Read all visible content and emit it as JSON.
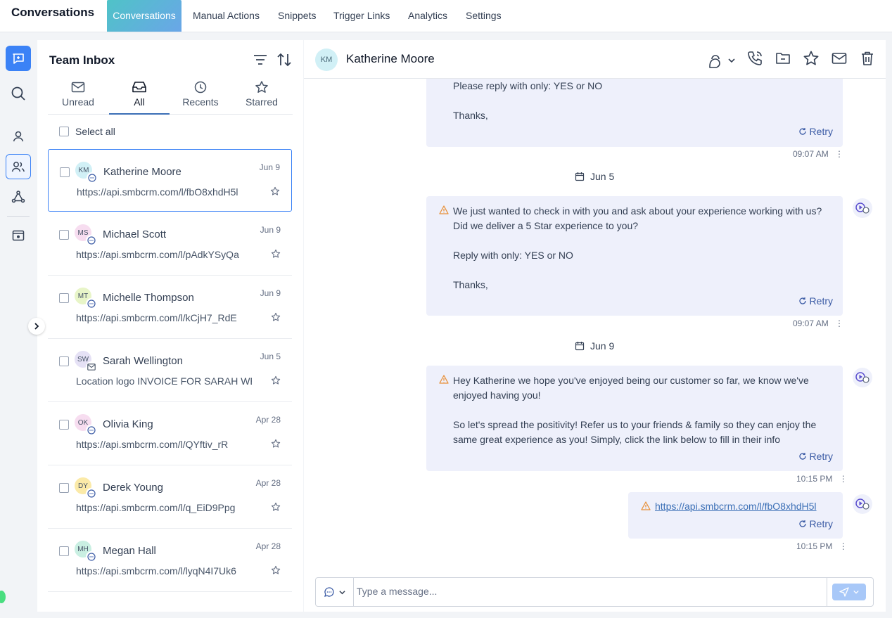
{
  "app": {
    "title": "Conversations"
  },
  "nav": {
    "tabs": [
      {
        "label": "Conversations",
        "active": true
      },
      {
        "label": "Manual Actions"
      },
      {
        "label": "Snippets"
      },
      {
        "label": "Trigger Links"
      },
      {
        "label": "Analytics"
      },
      {
        "label": "Settings"
      }
    ]
  },
  "rail": {
    "items": [
      "conversations-icon",
      "search-icon",
      "contact-icon",
      "team-icon",
      "workflow-icon",
      "preview-icon"
    ]
  },
  "inbox": {
    "title": "Team Inbox",
    "tabs": [
      {
        "label": "Unread",
        "icon": "inbox-icon"
      },
      {
        "label": "All",
        "icon": "tray-icon",
        "active": true
      },
      {
        "label": "Recents",
        "icon": "clock-icon"
      },
      {
        "label": "Starred",
        "icon": "star-icon"
      }
    ],
    "select_all": "Select all",
    "conversations": [
      {
        "initials": "KM",
        "name": "Katherine Moore",
        "date": "Jun 9",
        "preview": "https://api.smbcrm.com/l/fbO8xhdH5l",
        "channel": "chat",
        "color": "#d1f0f6"
      },
      {
        "initials": "MS",
        "name": "Michael Scott",
        "date": "Jun 9",
        "preview": "https://api.smbcrm.com/l/pAdkYSyQa",
        "channel": "chat",
        "color": "#f7ddf0"
      },
      {
        "initials": "MT",
        "name": "Michelle Thompson",
        "date": "Jun 9",
        "preview": "https://api.smbcrm.com/l/kCjH7_RdE",
        "channel": "chat",
        "color": "#e8f5c8"
      },
      {
        "initials": "SW",
        "name": "Sarah Wellington",
        "date": "Jun 5",
        "preview": "Location logo INVOICE FOR SARAH WELLINGTON",
        "channel": "email",
        "color": "#e5e1f5"
      },
      {
        "initials": "OK",
        "name": "Olivia King",
        "date": "Apr 28",
        "preview": "https://api.smbcrm.com/l/QYftiv_rR",
        "channel": "chat",
        "color": "#f7ddf0"
      },
      {
        "initials": "DY",
        "name": "Derek Young",
        "date": "Apr 28",
        "preview": "https://api.smbcrm.com/l/q_EiD9Ppg",
        "channel": "chat",
        "color": "#fbeaa8"
      },
      {
        "initials": "MH",
        "name": "Megan Hall",
        "date": "Apr 28",
        "preview": "https://api.smbcrm.com/l/lyqN4I7Uk6",
        "channel": "chat",
        "color": "#c9efe2"
      }
    ]
  },
  "chat": {
    "contact_initials": "KM",
    "contact_name": "Katherine Moore",
    "actions": [
      "support-agent-icon",
      "phone-icon",
      "folder-icon",
      "star-icon",
      "mail-icon",
      "trash-icon"
    ],
    "messages": [
      {
        "lines": [
          "Please reply with only: YES or NO",
          "",
          "Thanks,"
        ],
        "retry": "Retry",
        "time": "09:07 AM"
      },
      {
        "date": "Jun 5"
      },
      {
        "lines": [
          "We just wanted to check in with you and ask about your experience working with us? Did we deliver a 5 Star experience to you?",
          "",
          "Reply with only: YES or NO",
          "",
          "Thanks,"
        ],
        "retry": "Retry",
        "time": "09:07 AM"
      },
      {
        "date": "Jun 9"
      },
      {
        "lines": [
          "Hey Katherine we hope you've enjoyed being our customer so far, we know we've enjoyed having you!",
          "",
          "So let's spread the positivity! Refer us to your friends & family so they can enjoy the same great experience as you! Simply, click the link below to fill in their info"
        ],
        "retry": "Retry",
        "time": "10:15 PM"
      },
      {
        "link": "https://api.smbcrm.com/l/fbO8xhdH5l",
        "retry": "Retry",
        "time": "10:15 PM"
      }
    ],
    "composer": {
      "placeholder": "Type a message..."
    }
  },
  "colors": {
    "accent": "#3b82f6",
    "bubble": "#eef0fb",
    "warning": "#e8913a",
    "link": "#3b6fb6"
  }
}
